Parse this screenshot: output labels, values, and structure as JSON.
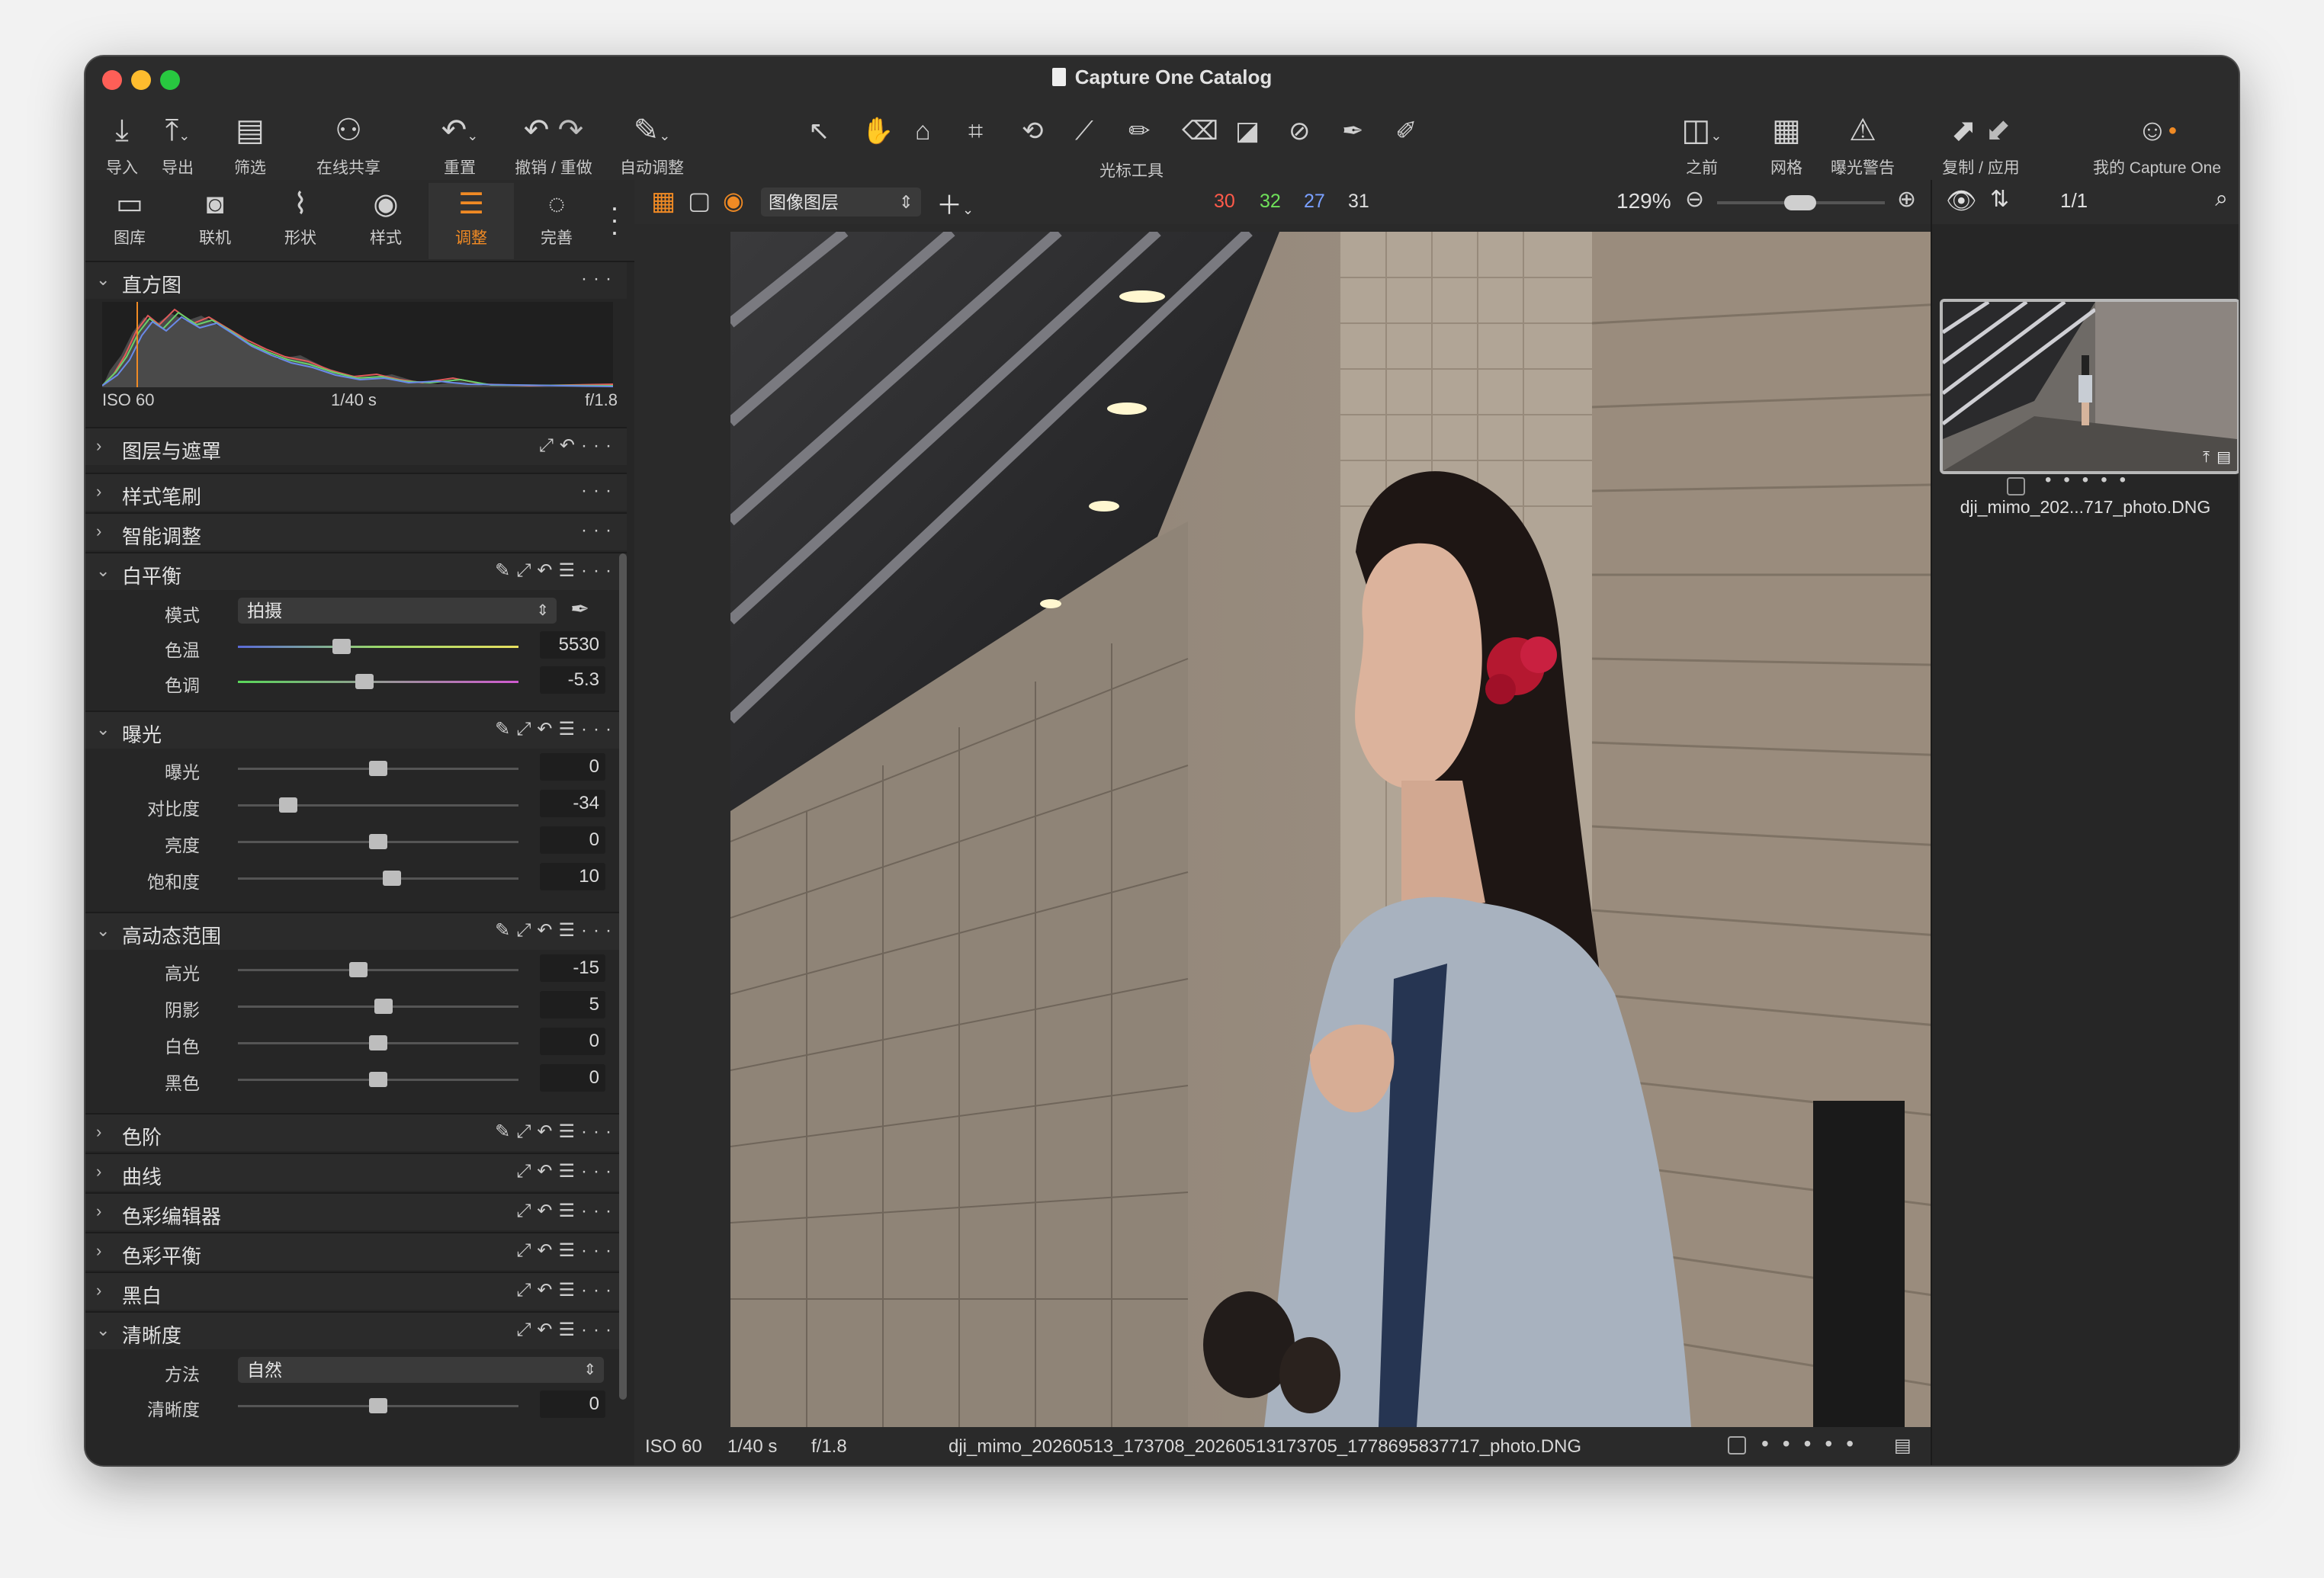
{
  "window": {
    "title": "Capture One Catalog"
  },
  "toolbar": {
    "items": [
      {
        "label": "导入",
        "icon": "import-icon"
      },
      {
        "label": "导出",
        "icon": "export-icon"
      },
      {
        "label": "筛选",
        "icon": "filter-icon"
      },
      {
        "label": "在线共享",
        "icon": "share-icon"
      },
      {
        "label": "重置",
        "icon": "reset-icon"
      },
      {
        "label": "撤销 / 重做",
        "icon": "undo-redo-icon"
      },
      {
        "label": "自动调整",
        "icon": "auto-adjust-icon"
      },
      {
        "label": "光标工具",
        "icon": "cursor-tools-icon"
      },
      {
        "label": "之前",
        "icon": "before-icon"
      },
      {
        "label": "网格",
        "icon": "grid-icon"
      },
      {
        "label": "曝光警告",
        "icon": "exposure-warning-icon"
      },
      {
        "label": "复制 / 应用",
        "icon": "copy-apply-icon"
      },
      {
        "label": "我的 Capture One",
        "icon": "account-icon"
      }
    ]
  },
  "tool_tabs": [
    {
      "label": "图库",
      "icon": "library-icon"
    },
    {
      "label": "联机",
      "icon": "tether-icon"
    },
    {
      "label": "形状",
      "icon": "lens-icon"
    },
    {
      "label": "样式",
      "icon": "styles-icon"
    },
    {
      "label": "调整",
      "icon": "adjust-icon",
      "active": true
    },
    {
      "label": "完善",
      "icon": "refine-icon"
    }
  ],
  "histogram": {
    "title": "直方图",
    "iso": "ISO 60",
    "shutter": "1/40 s",
    "aperture": "f/1.8"
  },
  "sections": {
    "layers": "图层与遮罩",
    "style_brush": "样式笔刷",
    "smart_adjust": "智能调整",
    "white_balance": "白平衡",
    "exposure": "曝光",
    "hdr": "高动态范围",
    "levels": "色阶",
    "curves": "曲线",
    "color_editor": "色彩编辑器",
    "color_balance": "色彩平衡",
    "bw": "黑白",
    "clarity": "清晰度"
  },
  "white_balance": {
    "mode_label": "模式",
    "mode_value": "拍摄",
    "sliders": [
      {
        "label": "色温",
        "value": "5530",
        "pos": 0.37
      },
      {
        "label": "色调",
        "value": "-5.3",
        "pos": 0.45
      }
    ]
  },
  "exposure": {
    "sliders": [
      {
        "label": "曝光",
        "value": "0",
        "pos": 0.5
      },
      {
        "label": "对比度",
        "value": "-34",
        "pos": 0.18
      },
      {
        "label": "亮度",
        "value": "0",
        "pos": 0.5
      },
      {
        "label": "饱和度",
        "value": "10",
        "pos": 0.55
      }
    ]
  },
  "hdr": {
    "sliders": [
      {
        "label": "高光",
        "value": "-15",
        "pos": 0.43
      },
      {
        "label": "阴影",
        "value": "5",
        "pos": 0.52
      },
      {
        "label": "白色",
        "value": "0",
        "pos": 0.5
      },
      {
        "label": "黑色",
        "value": "0",
        "pos": 0.5
      }
    ]
  },
  "clarity": {
    "method_label": "方法",
    "method_value": "自然",
    "sliders": [
      {
        "label": "清晰度",
        "value": "0",
        "pos": 0.5
      }
    ]
  },
  "viewer": {
    "layer_select": "图像图层",
    "readout": {
      "r": "30",
      "g": "32",
      "b": "27",
      "l": "31"
    },
    "readout_colors": {
      "r": "#ff5a4a",
      "g": "#6fe05a",
      "b": "#7aa0ff",
      "l": "#dddddd"
    },
    "zoom": "129%",
    "footer": {
      "iso": "ISO 60",
      "shutter": "1/40 s",
      "aperture": "f/1.8",
      "filename": "dji_mimo_20260513_173708_20260513173705_1778695837717_photo.DNG"
    }
  },
  "browser": {
    "counter": "1/1",
    "thumb_name": "dji_mimo_202...717_photo.DNG"
  },
  "accent_color": "#f08a24"
}
